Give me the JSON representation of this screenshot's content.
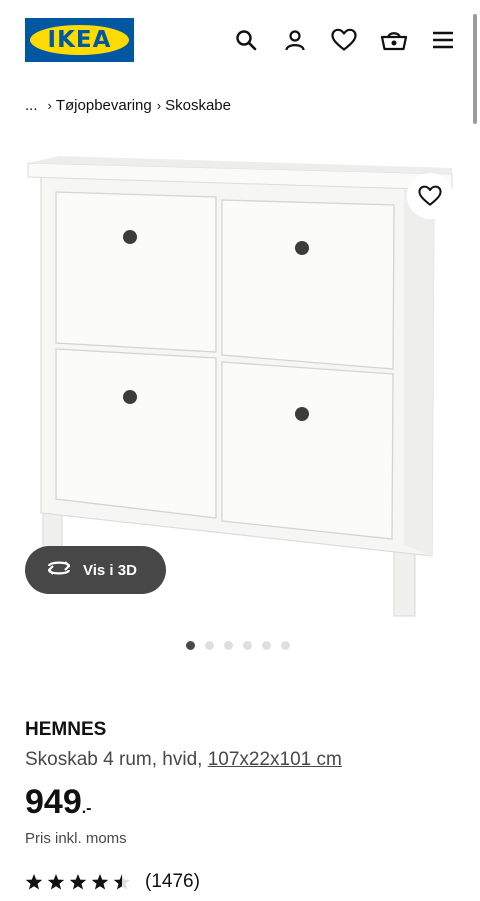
{
  "header": {
    "logo_text": "IKEA",
    "icons": [
      "search-icon",
      "user-icon",
      "heart-icon",
      "basket-icon",
      "menu-icon"
    ]
  },
  "breadcrumb": {
    "ellipsis": "...",
    "items": [
      "Tøjopbevaring",
      "Skoskabe"
    ]
  },
  "gallery": {
    "view_3d_label": "Vis i 3D",
    "image_count": 6,
    "active_index": 0
  },
  "product": {
    "name": "HEMNES",
    "description": "Skoskab 4 rum, hvid,",
    "dimensions": "107x22x101 cm",
    "price": "949",
    "price_suffix": ".-",
    "vat_note": "Pris inkl. moms",
    "rating": 4.5,
    "review_count": "(1476)"
  },
  "colors": {
    "logo_blue": "#0058a3",
    "logo_yellow": "#ffdb00",
    "text": "#111111",
    "muted_text": "#484848",
    "pill_bg": "#474747"
  }
}
